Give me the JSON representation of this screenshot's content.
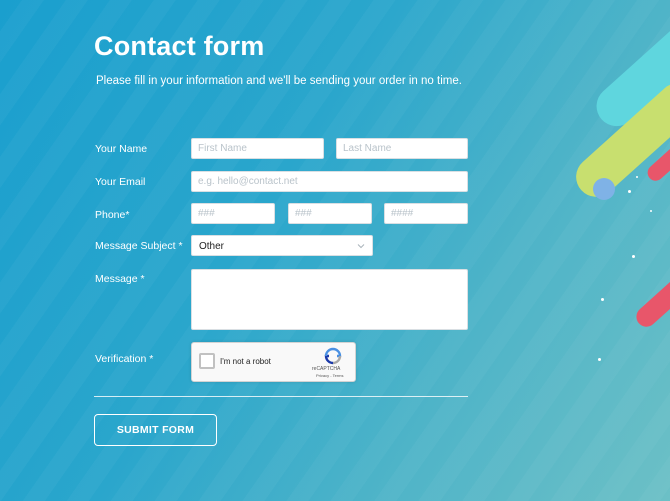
{
  "form": {
    "title": "Contact form",
    "subtitle": "Please fill in your information and we'll be sending your order in no time.",
    "name_label": "Your Name",
    "first_name_placeholder": "First Name",
    "last_name_placeholder": "Last Name",
    "email_label": "Your Email",
    "email_placeholder": "e.g. hello@contact.net",
    "phone_label": "Phone*",
    "phone_area_placeholder": "###",
    "phone_prefix_placeholder": "###",
    "phone_line_placeholder": "####",
    "subject_label": "Message Subject *",
    "subject_selected": "Other",
    "message_label": "Message *",
    "message_value": "",
    "verification_label": "Verification *",
    "submit_label": "SUBMIT FORM"
  },
  "captcha": {
    "checkbox_label": "I'm not a robot",
    "brand": "reCAPTCHA",
    "links": "Privacy - Terms"
  },
  "colors": {
    "background_start": "#1a9fce",
    "background_end": "#6cc0c6",
    "accent_yellow": "#c8df6f",
    "accent_cyan": "#5fd6de",
    "accent_red": "#e8566a"
  }
}
